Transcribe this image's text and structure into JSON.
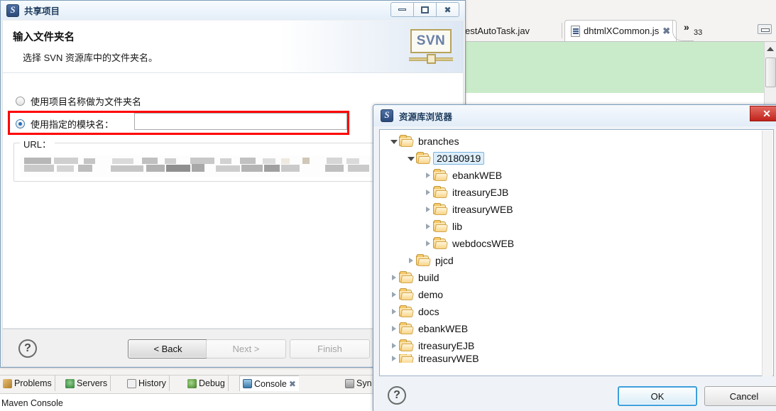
{
  "eclipse": {
    "editor_tabs": [
      {
        "label": "estAutoTask.jav",
        "active": false,
        "icon": "java-file-icon"
      },
      {
        "label": "dhtmlXCommon.js",
        "active": true,
        "icon": "js-file-icon"
      }
    ],
    "tab_overflow": {
      "chevron": "»",
      "count": "33"
    },
    "bottom_views": [
      {
        "label": "Problems",
        "icon": "problems-icon",
        "selected": false
      },
      {
        "label": "Servers",
        "icon": "servers-icon",
        "selected": false
      },
      {
        "label": "History",
        "icon": "history-icon",
        "selected": false
      },
      {
        "label": "Debug",
        "icon": "debug-icon",
        "selected": false
      },
      {
        "label": "Console",
        "icon": "console-icon",
        "selected": true
      },
      {
        "label": "Syn",
        "icon": "synchronize-icon",
        "selected": false
      }
    ],
    "console_label": "Maven Console",
    "editor_bg_color": "#c9ebc9"
  },
  "share_dialog": {
    "title": "共享项目",
    "window_buttons": {
      "minimize": "minimize-button",
      "maximize": "restore-button",
      "close": "close-button"
    },
    "header": {
      "title": "输入文件夹名",
      "subtitle": "选择 SVN 资源库中的文件夹名。",
      "logo_text": "SVN"
    },
    "options": [
      {
        "label": "使用项目名称做为文件夹名",
        "checked": false
      },
      {
        "label": "使用指定的模块名：",
        "checked": true
      }
    ],
    "module_input": {
      "value": "",
      "placeholder": ""
    },
    "url_group": {
      "legend": "URL：",
      "value": "",
      "redacted": true
    },
    "annotation": {
      "type": "red-highlight-box",
      "color": "#ff0000"
    },
    "footer": {
      "help": "?",
      "buttons": [
        {
          "label": "< Back",
          "underline": "B",
          "enabled": true,
          "default": true
        },
        {
          "label": "Next >",
          "underline": "N",
          "enabled": false,
          "default": false
        },
        {
          "label": "Finish",
          "underline": "F",
          "enabled": false,
          "default": false
        }
      ]
    }
  },
  "repo_dialog": {
    "title": "资源库浏览器",
    "close_label": "✕",
    "tree": [
      {
        "label": "branches",
        "depth": 0,
        "state": "expanded",
        "selected": false
      },
      {
        "label": "20180919",
        "depth": 1,
        "state": "expanded",
        "selected": true
      },
      {
        "label": "ebankWEB",
        "depth": 2,
        "state": "collapsed",
        "selected": false
      },
      {
        "label": "itreasuryEJB",
        "depth": 2,
        "state": "collapsed",
        "selected": false
      },
      {
        "label": "itreasuryWEB",
        "depth": 2,
        "state": "collapsed",
        "selected": false
      },
      {
        "label": "lib",
        "depth": 2,
        "state": "collapsed",
        "selected": false
      },
      {
        "label": "webdocsWEB",
        "depth": 2,
        "state": "collapsed",
        "selected": false
      },
      {
        "label": "pjcd",
        "depth": 1,
        "state": "collapsed",
        "selected": false
      },
      {
        "label": "build",
        "depth": 0,
        "state": "collapsed",
        "selected": false
      },
      {
        "label": "demo",
        "depth": 0,
        "state": "collapsed",
        "selected": false
      },
      {
        "label": "docs",
        "depth": 0,
        "state": "collapsed",
        "selected": false
      },
      {
        "label": "ebankWEB",
        "depth": 0,
        "state": "collapsed",
        "selected": false
      },
      {
        "label": "itreasuryEJB",
        "depth": 0,
        "state": "collapsed",
        "selected": false
      },
      {
        "label": "itreasuryWEB",
        "depth": 0,
        "state": "collapsed",
        "selected": false
      }
    ],
    "footer": {
      "help": "?",
      "ok_label": "OK",
      "cancel_label": "Cancel"
    }
  }
}
